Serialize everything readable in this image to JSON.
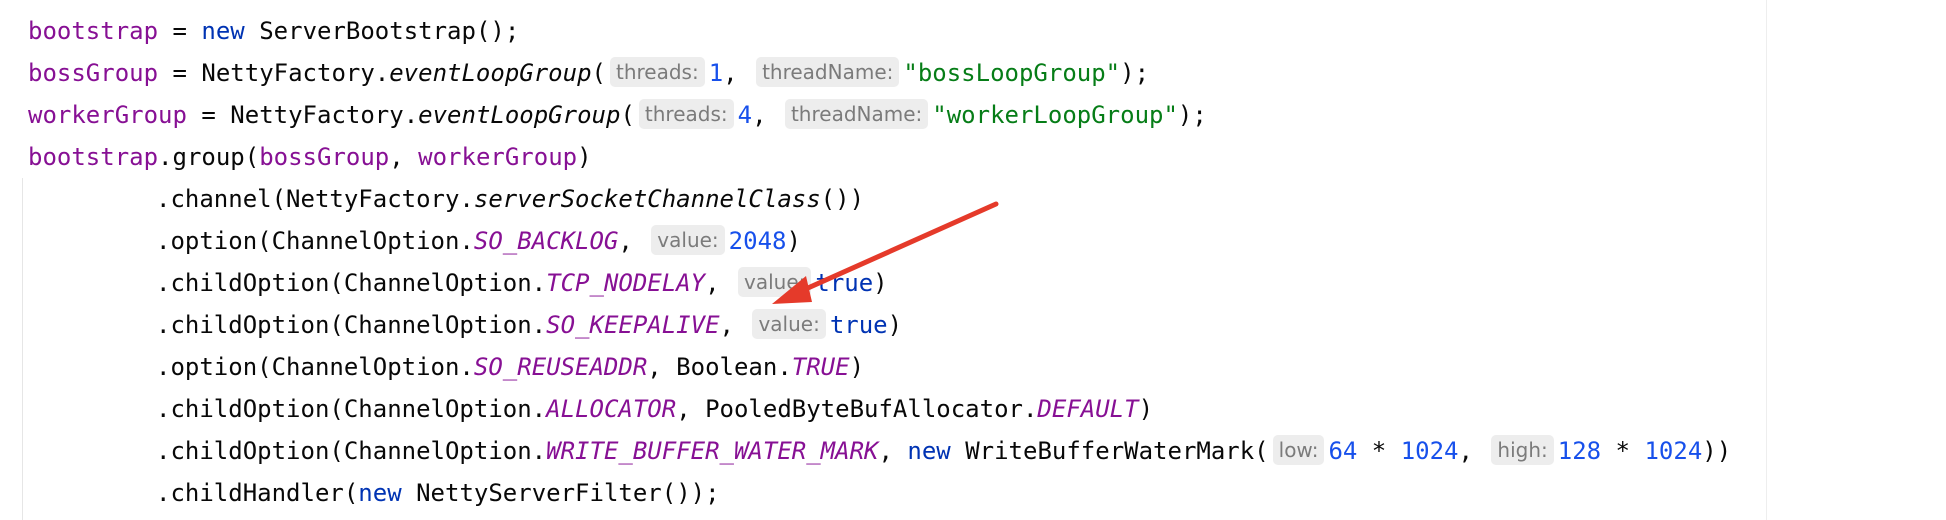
{
  "colors": {
    "background": "#ffffff",
    "field": "#871094",
    "keyword": "#0033b3",
    "number": "#1750eb",
    "string": "#067d17",
    "hint_bg": "#ededed",
    "hint_text": "#7b7b7b",
    "arrow": "#e53a2a"
  },
  "lines": [
    {
      "indent": false,
      "tokens": [
        {
          "t": "bootstrap",
          "c": "field"
        },
        {
          "t": " = ",
          "c": "plain"
        },
        {
          "t": "new",
          "c": "kw"
        },
        {
          "t": " ServerBootstrap();",
          "c": "plain"
        }
      ]
    },
    {
      "indent": false,
      "tokens": [
        {
          "t": "bossGroup",
          "c": "field"
        },
        {
          "t": " = NettyFactory.",
          "c": "plain"
        },
        {
          "t": "eventLoopGroup",
          "c": "method-italic"
        },
        {
          "t": "(",
          "c": "plain"
        },
        {
          "t": "threads:",
          "c": "hint"
        },
        {
          "t": "1",
          "c": "num"
        },
        {
          "t": ", ",
          "c": "plain"
        },
        {
          "t": "threadName:",
          "c": "hint"
        },
        {
          "t": "\"bossLoopGroup\"",
          "c": "str"
        },
        {
          "t": ");",
          "c": "plain"
        }
      ]
    },
    {
      "indent": false,
      "tokens": [
        {
          "t": "workerGroup",
          "c": "field"
        },
        {
          "t": " = NettyFactory.",
          "c": "plain"
        },
        {
          "t": "eventLoopGroup",
          "c": "method-italic"
        },
        {
          "t": "(",
          "c": "plain"
        },
        {
          "t": "threads:",
          "c": "hint"
        },
        {
          "t": "4",
          "c": "num"
        },
        {
          "t": ", ",
          "c": "plain"
        },
        {
          "t": "threadName:",
          "c": "hint"
        },
        {
          "t": "\"workerLoopGroup\"",
          "c": "str"
        },
        {
          "t": ");",
          "c": "plain"
        }
      ]
    },
    {
      "indent": false,
      "tokens": [
        {
          "t": "bootstrap",
          "c": "field"
        },
        {
          "t": ".group(",
          "c": "plain"
        },
        {
          "t": "bossGroup",
          "c": "field"
        },
        {
          "t": ", ",
          "c": "plain"
        },
        {
          "t": "workerGroup",
          "c": "field"
        },
        {
          "t": ")",
          "c": "plain"
        }
      ]
    },
    {
      "indent": true,
      "tokens": [
        {
          "t": ".channel(NettyFactory.",
          "c": "plain"
        },
        {
          "t": "serverSocketChannelClass",
          "c": "method-italic"
        },
        {
          "t": "())",
          "c": "plain"
        }
      ]
    },
    {
      "indent": true,
      "tokens": [
        {
          "t": ".option(ChannelOption.",
          "c": "plain"
        },
        {
          "t": "SO_BACKLOG",
          "c": "static-italic"
        },
        {
          "t": ", ",
          "c": "plain"
        },
        {
          "t": "value:",
          "c": "hint"
        },
        {
          "t": "2048",
          "c": "num"
        },
        {
          "t": ")",
          "c": "plain"
        }
      ]
    },
    {
      "indent": true,
      "tokens": [
        {
          "t": ".childOption(ChannelOption.",
          "c": "plain"
        },
        {
          "t": "TCP_NODELAY",
          "c": "static-italic"
        },
        {
          "t": ", ",
          "c": "plain"
        },
        {
          "t": "value:",
          "c": "hint"
        },
        {
          "t": "true",
          "c": "kw"
        },
        {
          "t": ")",
          "c": "plain"
        }
      ]
    },
    {
      "indent": true,
      "tokens": [
        {
          "t": ".childOption(ChannelOption.",
          "c": "plain"
        },
        {
          "t": "SO_KEEPALIVE",
          "c": "static-italic"
        },
        {
          "t": ", ",
          "c": "plain"
        },
        {
          "t": "value:",
          "c": "hint"
        },
        {
          "t": "true",
          "c": "kw"
        },
        {
          "t": ")",
          "c": "plain"
        }
      ]
    },
    {
      "indent": true,
      "tokens": [
        {
          "t": ".option(ChannelOption.",
          "c": "plain"
        },
        {
          "t": "SO_REUSEADDR",
          "c": "static-italic"
        },
        {
          "t": ", Boolean.",
          "c": "plain"
        },
        {
          "t": "TRUE",
          "c": "static-italic"
        },
        {
          "t": ")",
          "c": "plain"
        }
      ]
    },
    {
      "indent": true,
      "tokens": [
        {
          "t": ".childOption(ChannelOption.",
          "c": "plain"
        },
        {
          "t": "ALLOCATOR",
          "c": "static-italic"
        },
        {
          "t": ", PooledByteBufAllocator.",
          "c": "plain"
        },
        {
          "t": "DEFAULT",
          "c": "static-italic"
        },
        {
          "t": ")",
          "c": "plain"
        }
      ]
    },
    {
      "indent": true,
      "tokens": [
        {
          "t": ".childOption(ChannelOption.",
          "c": "plain"
        },
        {
          "t": "WRITE_BUFFER_WATER_MARK",
          "c": "static-italic"
        },
        {
          "t": ", ",
          "c": "plain"
        },
        {
          "t": "new",
          "c": "kw"
        },
        {
          "t": " WriteBufferWaterMark(",
          "c": "plain"
        },
        {
          "t": "low:",
          "c": "hint"
        },
        {
          "t": "64",
          "c": "num"
        },
        {
          "t": " * ",
          "c": "plain"
        },
        {
          "t": "1024",
          "c": "num"
        },
        {
          "t": ", ",
          "c": "plain"
        },
        {
          "t": "high:",
          "c": "hint"
        },
        {
          "t": "128",
          "c": "num"
        },
        {
          "t": " * ",
          "c": "plain"
        },
        {
          "t": "1024",
          "c": "num"
        },
        {
          "t": "))",
          "c": "plain"
        }
      ]
    },
    {
      "indent": true,
      "tokens": [
        {
          "t": ".childHandler(",
          "c": "plain"
        },
        {
          "t": "new",
          "c": "kw"
        },
        {
          "t": " NettyServerFilter());",
          "c": "plain"
        }
      ]
    }
  ]
}
